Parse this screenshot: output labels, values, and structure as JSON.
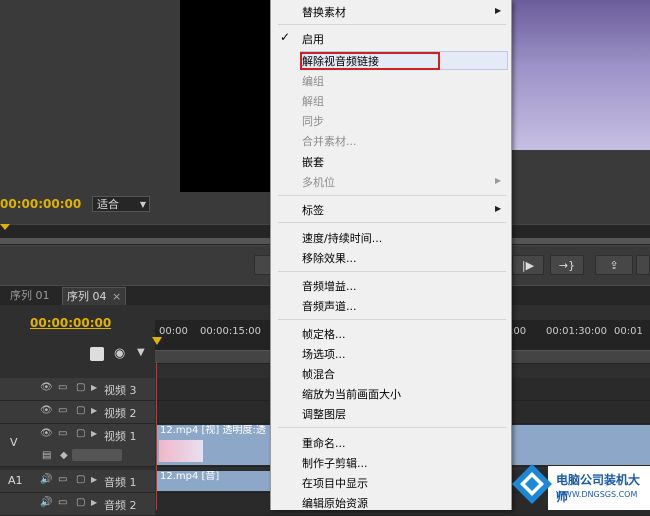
{
  "monitor": {
    "timecode": "00:00:00:00",
    "fit": "适合"
  },
  "timeline": {
    "tabs": [
      "序列 01",
      "序列 04"
    ],
    "tab_close": "×",
    "timecode": "00:00:00:00",
    "ruler": [
      "00:00",
      "00:00:15:00",
      ":00",
      "00:01:30:00",
      "00:01"
    ],
    "tracks": [
      {
        "label": "视频 3"
      },
      {
        "label": "视频 2"
      },
      {
        "label": "视频 1",
        "target": "V"
      },
      {
        "label": "音频 1",
        "target": "A1"
      },
      {
        "label": "音频 2"
      }
    ],
    "video_clip": "12.mp4 [视] 透明度:透",
    "audio_clip": "12.mp4 [音]"
  },
  "context_menu": {
    "items": [
      {
        "label": "替换素材",
        "enabled": true,
        "submenu": true
      },
      {
        "label": "启用",
        "enabled": true,
        "checked": true
      },
      {
        "label": "解除视音频链接",
        "enabled": true,
        "highlighted": true
      },
      {
        "label": "编组",
        "enabled": false
      },
      {
        "label": "解组",
        "enabled": false
      },
      {
        "label": "同步",
        "enabled": false
      },
      {
        "label": "合并素材...",
        "enabled": false
      },
      {
        "label": "嵌套",
        "enabled": true
      },
      {
        "label": "多机位",
        "enabled": false,
        "submenu": true
      },
      {
        "label": "标签",
        "enabled": true,
        "submenu": true
      },
      {
        "label": "速度/持续时间...",
        "enabled": true
      },
      {
        "label": "移除效果...",
        "enabled": true
      },
      {
        "label": "音频增益...",
        "enabled": true
      },
      {
        "label": "音频声道...",
        "enabled": true
      },
      {
        "label": "帧定格...",
        "enabled": true
      },
      {
        "label": "场选项...",
        "enabled": true
      },
      {
        "label": "帧混合",
        "enabled": true
      },
      {
        "label": "缩放为当前画面大小",
        "enabled": true
      },
      {
        "label": "调整图层",
        "enabled": true
      },
      {
        "label": "重命名...",
        "enabled": true
      },
      {
        "label": "制作子剪辑...",
        "enabled": true
      },
      {
        "label": "在项目中显示",
        "enabled": true
      },
      {
        "label": "编辑原始资源",
        "enabled": true
      }
    ]
  },
  "watermark": {
    "title": "电脑公司装机大师",
    "url": "WWW.DNGSGS.COM"
  },
  "colors": {
    "timecode": "#e0b300",
    "highlight_box": "#d02020",
    "menu_bg": "#f0f0f0",
    "clip": "#8da7c8"
  }
}
